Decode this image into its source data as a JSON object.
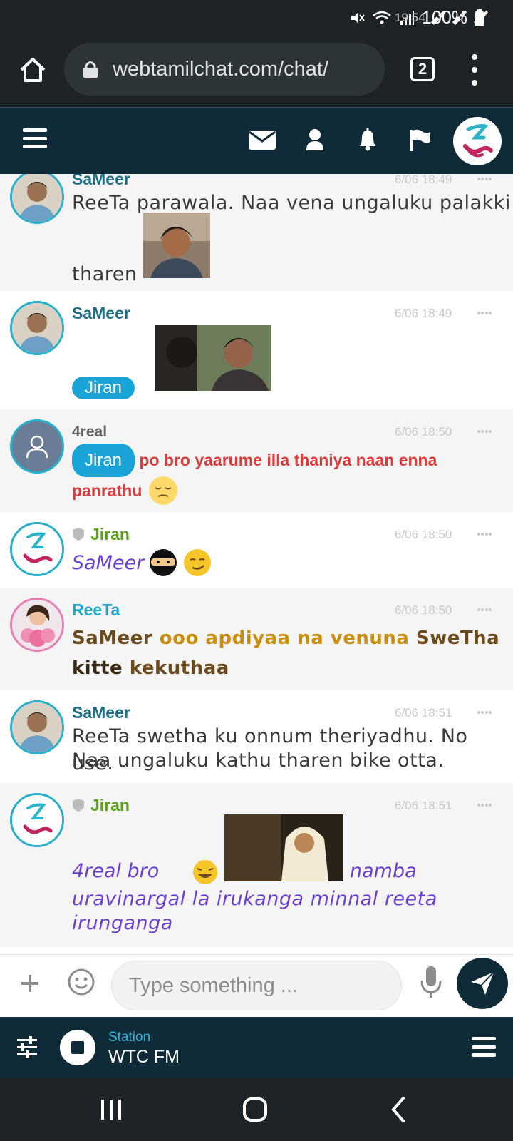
{
  "status_bar": {
    "time": "19:54",
    "battery": "100%"
  },
  "browser": {
    "url": "webtamilchat.com/chat/",
    "tab_count": "2"
  },
  "messages": [
    {
      "user": "SaMeer",
      "time": "6/06 18:49",
      "line1": "ReeTa parawala. Naa vena ungaluku palakki",
      "line2": "tharen"
    },
    {
      "user": "SaMeer",
      "time": "6/06 18:49",
      "mention": "Jiran"
    },
    {
      "user": "4real",
      "time": "6/06 18:50",
      "mention": "Jiran",
      "text_a": "po bro yaarume illa thaniya naan enna",
      "text_b": "panrathu"
    },
    {
      "user": "Jiran",
      "time": "6/06 18:50",
      "text": "SaMeer"
    },
    {
      "user": "ReeTa",
      "time": "6/06 18:50",
      "text_a1": "SaMeer ",
      "text_a2": "ooo apdiyaa na venuna ",
      "text_a3": "SweTha",
      "text_b1": "kitte ",
      "text_b2": "kekuthaa"
    },
    {
      "user": "SaMeer",
      "time": "6/06 18:51",
      "line1": "ReeTa swetha ku onnum theriyadhu. No use.",
      "line2": "Naa ungaluku kathu tharen bike otta."
    },
    {
      "user": "Jiran",
      "time": "6/06 18:51",
      "text_a": "4real bro",
      "text_b": "namba",
      "line2": "uravinargal la irukanga minnal reeta",
      "line3": "irunganga"
    }
  ],
  "composer": {
    "placeholder": "Type something ..."
  },
  "radio": {
    "label": "Station",
    "name": "WTC FM"
  },
  "colors": {
    "header_bg": "#0f2b38",
    "accent": "#1aa3d6",
    "jiran_green": "#5aa416",
    "alert_red": "#e03a3a"
  },
  "icons": [
    "home-icon",
    "lock-icon",
    "menu-icon",
    "mail-icon",
    "user-icon",
    "bell-icon",
    "flag-icon",
    "plus-icon",
    "smile-icon",
    "mic-icon",
    "send-icon",
    "sliders-icon",
    "stop-icon"
  ]
}
